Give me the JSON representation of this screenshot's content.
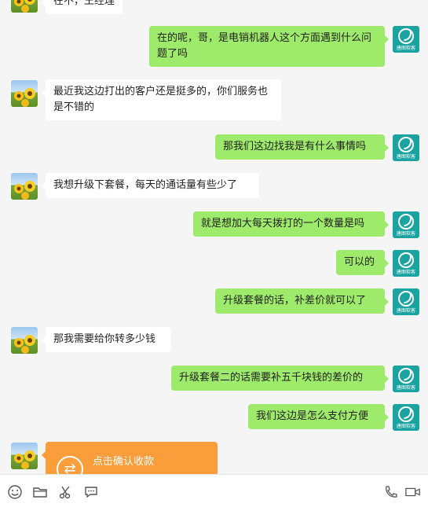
{
  "messages": [
    {
      "side": "left",
      "text": "在不，王经理"
    },
    {
      "side": "right",
      "text": "在的呢，哥，是电销机器人这个方面遇到什么问题了吗"
    },
    {
      "side": "left",
      "text": "最近我这边打出的客户还是挺多的，你们服务也是不错的"
    },
    {
      "side": "right",
      "text": "那我们这边找我是有什么事情吗"
    },
    {
      "side": "left",
      "text": "我想升级下套餐，每天的通话量有些少了"
    },
    {
      "side": "right",
      "text": "就是想加大每天拨打的一个数量是吗"
    },
    {
      "side": "right",
      "text": "可以的"
    },
    {
      "side": "right",
      "text": "升级套餐的话，补差价就可以了"
    },
    {
      "side": "left",
      "text": "那我需要给你转多少钱"
    },
    {
      "side": "right",
      "text": "升级套餐二的话需要补五千块钱的差价的"
    },
    {
      "side": "right",
      "text": "我们这边是怎么支付方便"
    }
  ],
  "transfer": {
    "label": "点击确认收款"
  },
  "brand_avatar_caption": "唐图软客",
  "colors": {
    "right_bubble": "#9eea6a",
    "left_bubble": "#ffffff",
    "transfer": "#fa9d3b"
  }
}
